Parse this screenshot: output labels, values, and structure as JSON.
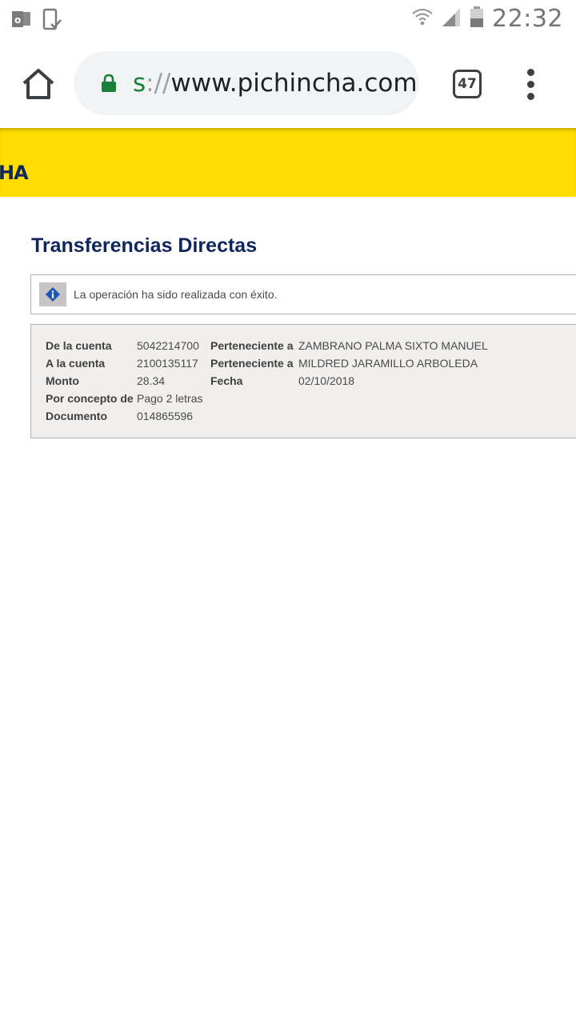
{
  "status_bar": {
    "time": "22:32",
    "left_icons": [
      "outlook-icon",
      "device-check-icon"
    ],
    "right_icons": [
      "wifi-icon",
      "signal-icon",
      "battery-icon"
    ]
  },
  "browser": {
    "url_scheme": "s",
    "url_separator": "://",
    "url_host": "www.pichincha.com",
    "tab_count": "47",
    "colors": {
      "pill": "#f1f3f4",
      "lock": "#188038"
    }
  },
  "banner": {
    "logo_text": "HA",
    "color": "#ffdd00"
  },
  "page": {
    "title": "Transferencias Directas",
    "alert_message": "La operación ha sido realizada con éxito."
  },
  "details": {
    "from_account_label": "De la cuenta",
    "from_account_value": "5042214700",
    "from_owner_label": "Perteneciente a",
    "from_owner_value": "ZAMBRANO PALMA SIXTO MANUEL",
    "to_account_label": "A la cuenta",
    "to_account_value": "2100135117",
    "to_owner_label": "Perteneciente a",
    "to_owner_value": "MILDRED JARAMILLO ARBOLEDA",
    "amount_label": "Monto",
    "amount_value": "28.34",
    "date_label": "Fecha",
    "date_value": "02/10/2018",
    "concept_label": "Por concepto de",
    "concept_value": "Pago 2 letras",
    "document_label": "Documento",
    "document_value": "014865596"
  }
}
